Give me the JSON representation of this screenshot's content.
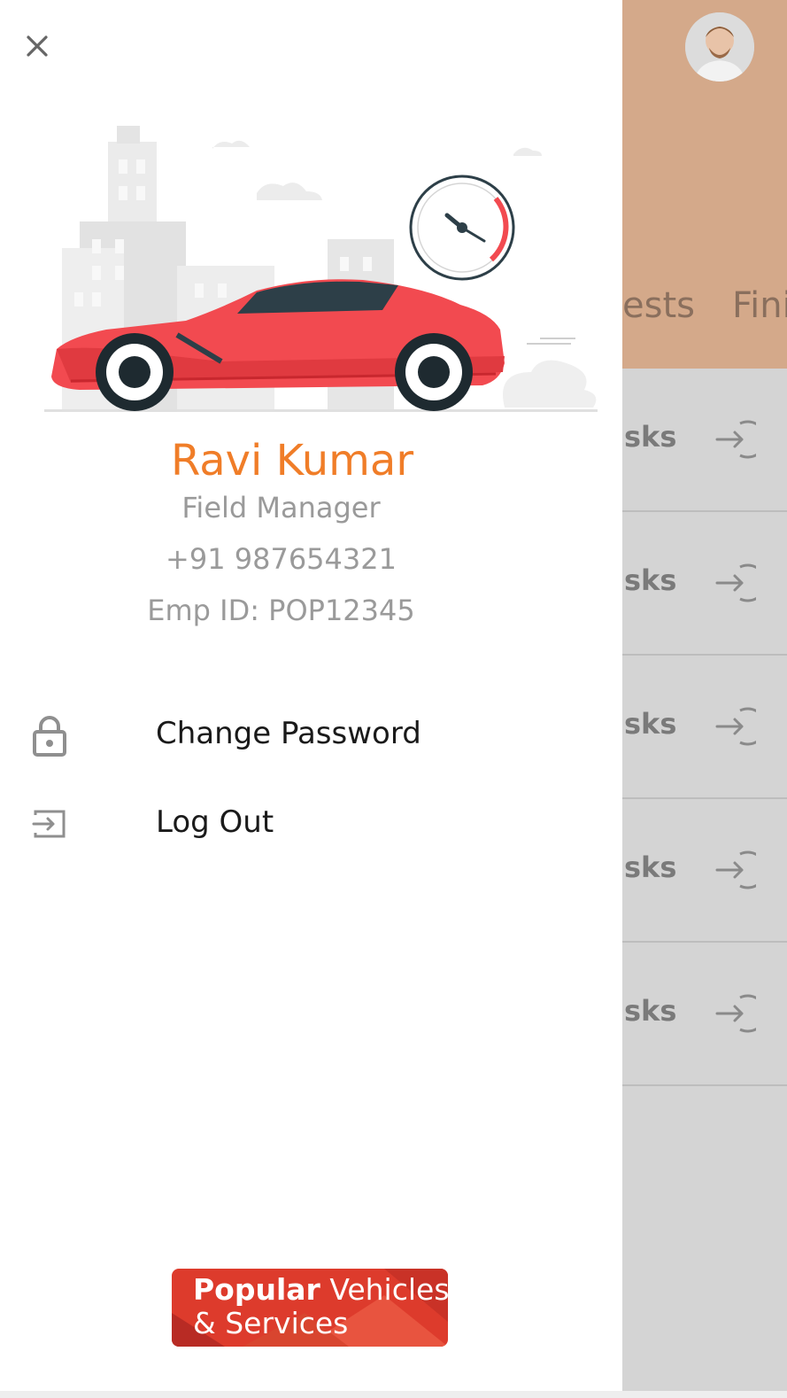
{
  "background": {
    "tabs": [
      "ests",
      "Fini"
    ],
    "rows": [
      {
        "label": "sks"
      },
      {
        "label": "sks"
      },
      {
        "label": "sks"
      },
      {
        "label": "sks"
      },
      {
        "label": "sks"
      }
    ]
  },
  "drawer": {
    "user": {
      "name": "Ravi Kumar",
      "role": "Field Manager",
      "phone": "+91 987654321",
      "emp_id": "Emp ID: POP12345"
    },
    "menu": [
      {
        "label": "Change Password",
        "icon": "lock-icon"
      },
      {
        "label": "Log Out",
        "icon": "logout-icon"
      }
    ],
    "logo": {
      "bold": "Popular",
      "line1_rest": " Vehicles",
      "line2": "& Services"
    }
  },
  "colors": {
    "accent": "#f07d28",
    "header_bg": "#d4a98a",
    "logo_red": "#dd3b2c",
    "car_red": "#f24a50"
  }
}
